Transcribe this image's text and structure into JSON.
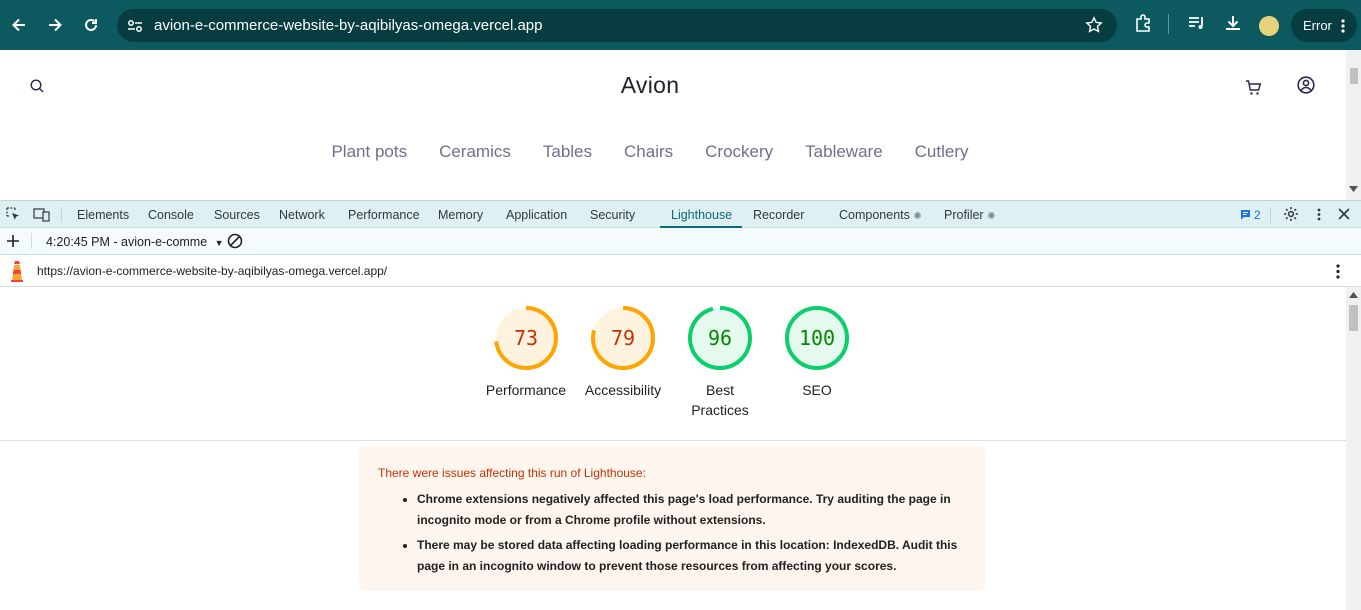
{
  "browser": {
    "url": "avion-e-commerce-website-by-aqibilyas-omega.vercel.app",
    "profile_label": "Error"
  },
  "site": {
    "brand": "Avion",
    "categories": [
      "Plant pots",
      "Ceramics",
      "Tables",
      "Chairs",
      "Crockery",
      "Tableware",
      "Cutlery"
    ]
  },
  "devtools": {
    "tabs": [
      "Elements",
      "Console",
      "Sources",
      "Network",
      "Performance",
      "Memory",
      "Application",
      "Security",
      "Lighthouse",
      "Recorder",
      "Components",
      "Profiler"
    ],
    "active_tab": "Lighthouse",
    "message_count": "2",
    "report_selector": "4:20:45 PM - avion-e-comme",
    "report_url": "https://avion-e-commerce-website-by-aqibilyas-omega.vercel.app/"
  },
  "lighthouse": {
    "scores": [
      {
        "label": "Performance",
        "score": 73,
        "color": "#ffa400",
        "text_color": "#c33300",
        "bg": "#fff3e0"
      },
      {
        "label": "Accessibility",
        "score": 79,
        "color": "#ffa400",
        "text_color": "#c33300",
        "bg": "#fff3e0"
      },
      {
        "label": "Best Practices",
        "score": 96,
        "color": "#0cce6b",
        "text_color": "#008800",
        "bg": "#e6f9ee"
      },
      {
        "label": "SEO",
        "score": 100,
        "color": "#0cce6b",
        "text_color": "#008800",
        "bg": "#e6f9ee"
      }
    ],
    "warning_title": "There were issues affecting this run of Lighthouse:",
    "warnings": [
      "Chrome extensions negatively affected this page's load performance. Try auditing the page in incognito mode or from a Chrome profile without extensions.",
      "There may be stored data affecting loading performance in this location: IndexedDB. Audit this page in an incognito window to prevent those resources from affecting your scores."
    ]
  }
}
